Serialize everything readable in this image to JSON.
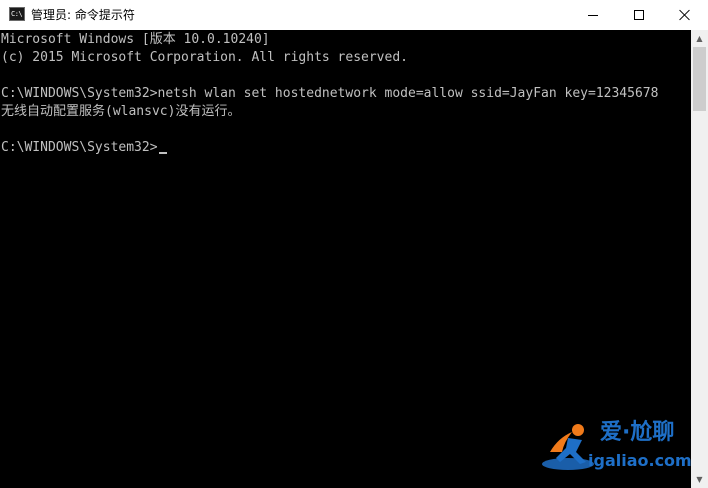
{
  "window": {
    "title": "管理员: 命令提示符",
    "icon": "cmd-icon",
    "icon_glyph": "C:\\",
    "controls": {
      "minimize": "minimize-icon",
      "maximize": "maximize-icon",
      "close": "close-icon"
    }
  },
  "console": {
    "lines": [
      "Microsoft Windows [版本 10.0.10240]",
      "(c) 2015 Microsoft Corporation. All rights reserved.",
      "",
      "C:\\WINDOWS\\System32>netsh wlan set hostednetwork mode=allow ssid=JayFan key=12345678",
      "无线自动配置服务(wlansvc)没有运行。",
      "",
      "C:\\WINDOWS\\System32>"
    ],
    "text_color": "#c0c0c0",
    "background": "#000000"
  },
  "scrollbar": {
    "up_arrow": "▲",
    "down_arrow": "▼"
  },
  "watermark": {
    "top": "爱·尬聊",
    "bottom": "igaliao.com",
    "color": "#1e6fc7",
    "accent": "#f07a1a"
  }
}
